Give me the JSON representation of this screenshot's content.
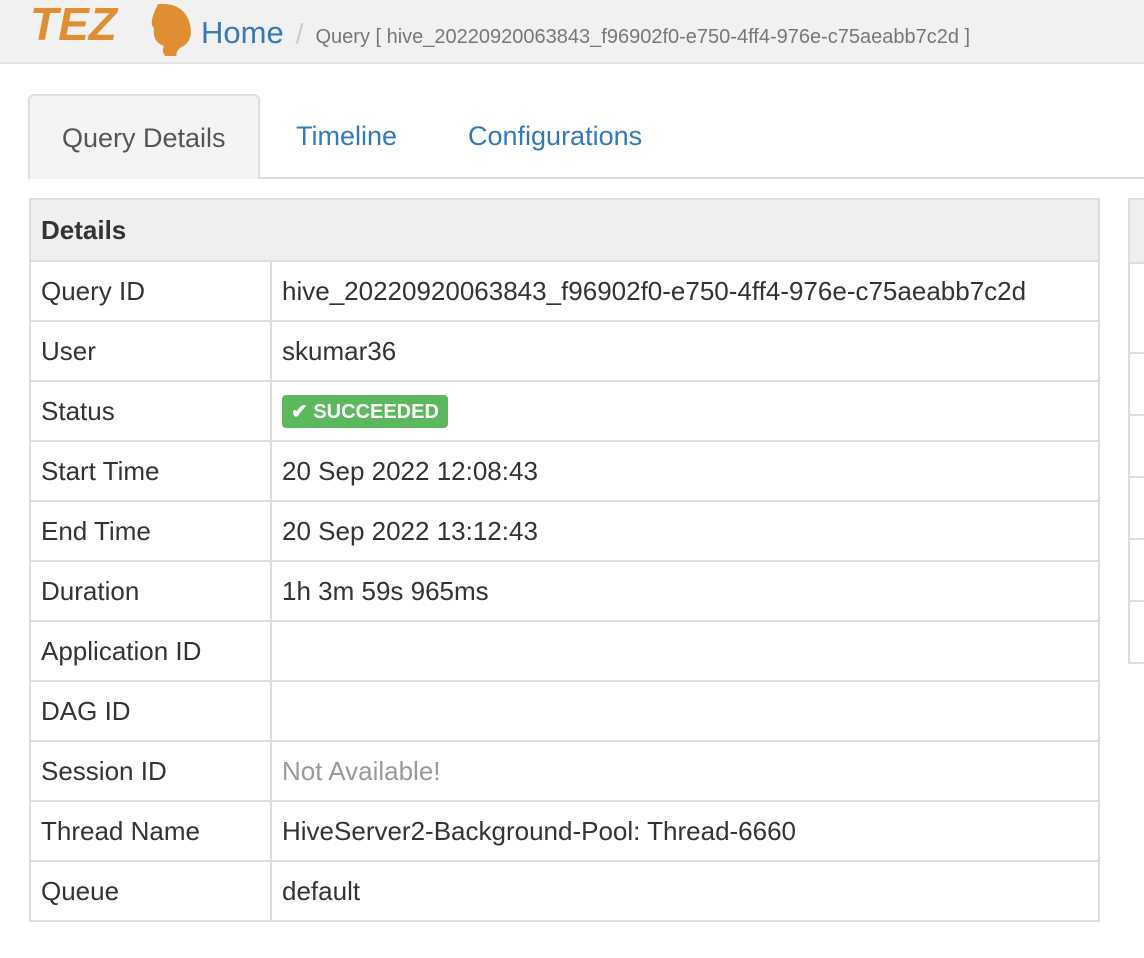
{
  "header": {
    "logo_text": "TEZ",
    "breadcrumbs": [
      {
        "label": "Home"
      },
      {
        "label": "Query [ hive_20220920063843_f96902f0-e750-4ff4-976e-c75aeabb7c2d ]"
      }
    ]
  },
  "tabs": [
    {
      "label": "Query Details",
      "active": true
    },
    {
      "label": "Timeline"
    },
    {
      "label": "Configurations"
    }
  ],
  "details": {
    "title": "Details",
    "rows": [
      {
        "label": "Query ID",
        "value": "hive_20220920063843_f96902f0-e750-4ff4-976e-c75aeabb7c2d"
      },
      {
        "label": "User",
        "value": "skumar36"
      },
      {
        "label": "Status",
        "value": "SUCCEEDED"
      },
      {
        "label": "Start Time",
        "value": "20 Sep 2022 12:08:43"
      },
      {
        "label": "End Time",
        "value": "20 Sep 2022 13:12:43"
      },
      {
        "label": "Duration",
        "value": "1h 3m 59s 965ms"
      },
      {
        "label": "Application ID",
        "value": ""
      },
      {
        "label": "DAG ID",
        "value": ""
      },
      {
        "label": "Session ID",
        "value": "Not Available!"
      },
      {
        "label": "Thread Name",
        "value": "HiveServer2-Background-Pool: Thread-6660"
      },
      {
        "label": "Queue",
        "value": "default"
      }
    ]
  },
  "colors": {
    "success": "#5cb85c",
    "link": "#337ab7",
    "logo": "#e08e32"
  }
}
